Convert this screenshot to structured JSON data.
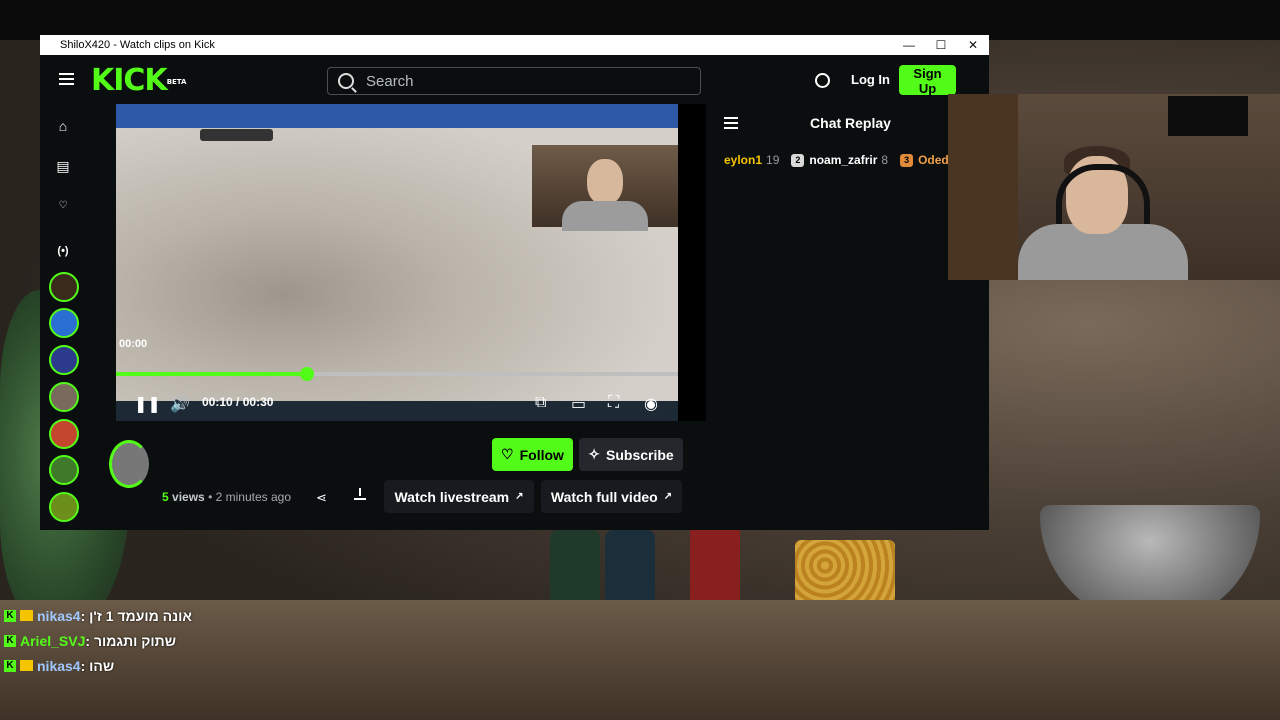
{
  "window": {
    "title": "ShiloX420 - Watch clips on Kick",
    "minimize": "—",
    "maximize": "☐",
    "close": "✕"
  },
  "nav": {
    "logo": "KICK",
    "logo_badge": "BETA",
    "search_placeholder": "Search",
    "login": "Log In",
    "signup": "Sign Up"
  },
  "player": {
    "timestamp": "00:00",
    "current_time": "00:10",
    "separator": "/",
    "duration": "00:30",
    "progress": 0.34
  },
  "chat_replay": {
    "title": "Chat Replay",
    "leaders": [
      {
        "rank": "",
        "name": "eylon1",
        "count": "19",
        "name_color": "#f5c400"
      },
      {
        "rank": "2",
        "name": "noam_zafrir",
        "count": "8",
        "name_color": "#ffffff"
      },
      {
        "rank": "3",
        "name": "Oded",
        "count": "",
        "name_color": "#f0a048"
      }
    ]
  },
  "actions": {
    "follow": "Follow",
    "subscribe": "Subscribe",
    "views_count": "5",
    "views_label": "views",
    "dot": "•",
    "posted": "2 minutes ago",
    "watch_livestream": "Watch livestream",
    "watch_full_video": "Watch full video"
  },
  "stream_chat": [
    {
      "user": "nikas4",
      "message": ": אונה מועמד 1 ז'ן",
      "user_color": "#9ec7ff"
    },
    {
      "user": "Ariel_SVJ",
      "message": ": שתוק ותגמור",
      "user_color": "#53fc18"
    },
    {
      "user": "nikas4",
      "message": ": שהו",
      "user_color": "#9ec7ff"
    }
  ],
  "colors": {
    "brand": "#53fc18",
    "app_bg": "#0b0e0f",
    "button_dark": "#24272c"
  }
}
